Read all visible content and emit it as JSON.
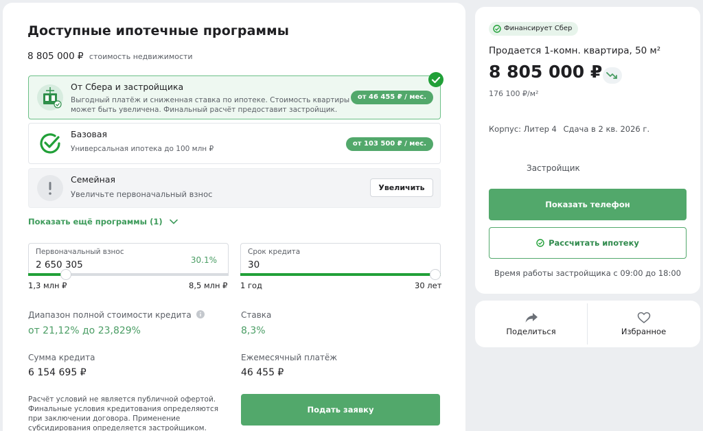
{
  "header": {
    "title": "Доступные ипотечные программы",
    "property_price": "8 805 000 ₽",
    "property_price_hint": "стоимость недвижимости"
  },
  "programs": [
    {
      "title": "От Сбера и застройщика",
      "description_line1": "Выгодный платёж и сниженная ставка по ипотеке. Стоимость квартиры",
      "description_line2": "может быть увеличена. Финальный расчёт предоставит застройщик.",
      "payment": "от 46 455 ₽ / мес.",
      "selected": true,
      "icon": "building-icon"
    },
    {
      "title": "Базовая",
      "description_line1": "Универсальная ипотека до 100 млн ₽",
      "payment": "от 103 500 ₽ / мес.",
      "selected": false,
      "icon": "check-circle-icon"
    },
    {
      "title": "Семейная",
      "description_line1": "Увеличьте первоначальный взнос",
      "action_label": "Увеличить",
      "selected": false,
      "icon": "exclamation-icon"
    }
  ],
  "more_programs_label": "Показать ещё программы (1)",
  "down_payment": {
    "label": "Первоначальный взнос",
    "value": "2 650 305",
    "percent": "30.1%",
    "min_label": "1,3 млн ₽",
    "max_label": "8,5 млн ₽",
    "slider_fraction": 0.188
  },
  "loan_term": {
    "label": "Срок кредита",
    "value": "30",
    "min_label": "1 год",
    "max_label": "30 лет",
    "slider_fraction": 1.0
  },
  "stats": {
    "cost_range_label": "Диапазон полной стоимости кредита",
    "cost_range_value": "от 21,12% до 23,829%",
    "rate_label": "Ставка",
    "rate_value": "8,3%",
    "loan_sum_label": "Сумма кредита",
    "loan_sum_value": "6 154 695 ₽",
    "monthly_label": "Ежемесячный платёж",
    "monthly_value": "46 455 ₽"
  },
  "disclaimer": "Расчёт условий не является публичной офертой. Финальные условия кредитования определяются при заключении договора. Применение субсидирования определяется застройщиком.",
  "apply_label": "Подать заявку",
  "listing": {
    "financing_badge": "Финансирует Сбер",
    "flat_title": "Продается 1-комн. квартира, 50 м²",
    "price": "8 805 000 ₽",
    "price_per_meter": "176 100 ₽/м²",
    "building": "Корпус: Литер 4",
    "delivery": "Сдача в 2 кв. 2026 г.",
    "developer_label": "Застройщик",
    "show_phone_label": "Показать телефон",
    "calc_mortgage_label": "Рассчитать ипотеку",
    "working_hours": "Время работы застройщика с 09:00 до 18:00"
  },
  "actions": {
    "share_label": "Поделиться",
    "favorite_label": "Избранное"
  },
  "colors": {
    "accent": "#21a038",
    "accent_soft": "#52a86b",
    "text_green": "#4a9d64"
  }
}
